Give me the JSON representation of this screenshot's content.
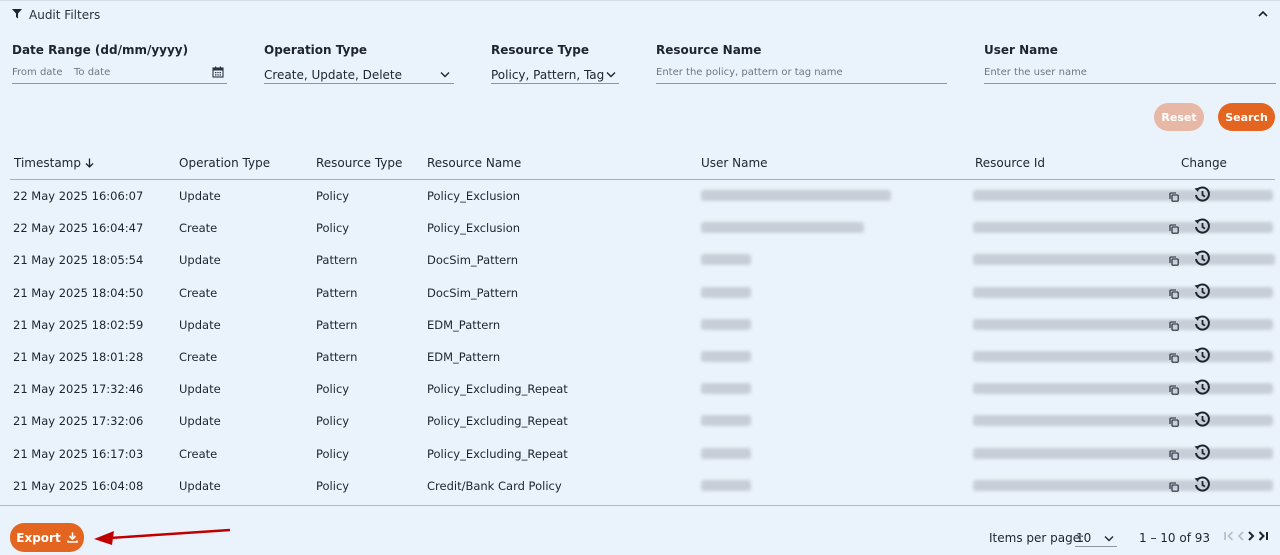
{
  "filters": {
    "title": "Audit Filters",
    "date_range": {
      "label": "Date Range (dd/mm/yyyy)",
      "from_placeholder": "From date",
      "to_placeholder": "To date"
    },
    "operation_type": {
      "label": "Operation Type",
      "value": "Create, Update, Delete"
    },
    "resource_type": {
      "label": "Resource Type",
      "value": "Policy, Pattern, Tag"
    },
    "resource_name": {
      "label": "Resource Name",
      "placeholder": "Enter the policy, pattern or tag name"
    },
    "user_name": {
      "label": "User Name",
      "placeholder": "Enter the user name"
    },
    "reset_label": "Reset",
    "search_label": "Search"
  },
  "table": {
    "headers": {
      "timestamp": "Timestamp",
      "operation_type": "Operation Type",
      "resource_type": "Resource Type",
      "resource_name": "Resource Name",
      "user_name": "User Name",
      "resource_id": "Resource Id",
      "change": "Change"
    },
    "rows": [
      {
        "timestamp": "22 May 2025 16:06:07",
        "operation": "Update",
        "resource_type": "Policy",
        "resource_name": "Policy_Exclusion"
      },
      {
        "timestamp": "22 May 2025 16:04:47",
        "operation": "Create",
        "resource_type": "Policy",
        "resource_name": "Policy_Exclusion"
      },
      {
        "timestamp": "21 May 2025 18:05:54",
        "operation": "Update",
        "resource_type": "Pattern",
        "resource_name": "DocSim_Pattern"
      },
      {
        "timestamp": "21 May 2025 18:04:50",
        "operation": "Create",
        "resource_type": "Pattern",
        "resource_name": "DocSim_Pattern"
      },
      {
        "timestamp": "21 May 2025 18:02:59",
        "operation": "Update",
        "resource_type": "Pattern",
        "resource_name": "EDM_Pattern"
      },
      {
        "timestamp": "21 May 2025 18:01:28",
        "operation": "Create",
        "resource_type": "Pattern",
        "resource_name": "EDM_Pattern"
      },
      {
        "timestamp": "21 May 2025 17:32:46",
        "operation": "Update",
        "resource_type": "Policy",
        "resource_name": "Policy_Excluding_Repeat"
      },
      {
        "timestamp": "21 May 2025 17:32:06",
        "operation": "Update",
        "resource_type": "Policy",
        "resource_name": "Policy_Excluding_Repeat"
      },
      {
        "timestamp": "21 May 2025 16:17:03",
        "operation": "Create",
        "resource_type": "Policy",
        "resource_name": "Policy_Excluding_Repeat"
      },
      {
        "timestamp": "21 May 2025 16:04:08",
        "operation": "Update",
        "resource_type": "Policy",
        "resource_name": "Credit/Bank Card Policy"
      }
    ]
  },
  "footer": {
    "export_label": "Export",
    "items_per_page_label": "Items per page:",
    "items_per_page_value": "10",
    "range_text": "1 – 10 of 93"
  },
  "colors": {
    "accent": "#e4651f",
    "accent_disabled": "#e8b8a6",
    "background": "#eaf2fb",
    "annotation_arrow": "#c00000"
  },
  "icons": [
    "filter-icon",
    "chevron-up-icon",
    "calendar-icon",
    "chevron-down-icon",
    "sort-arrow-down-icon",
    "copy-icon",
    "history-icon",
    "download-icon",
    "first-page-icon",
    "previous-page-icon",
    "next-page-icon",
    "last-page-icon"
  ]
}
